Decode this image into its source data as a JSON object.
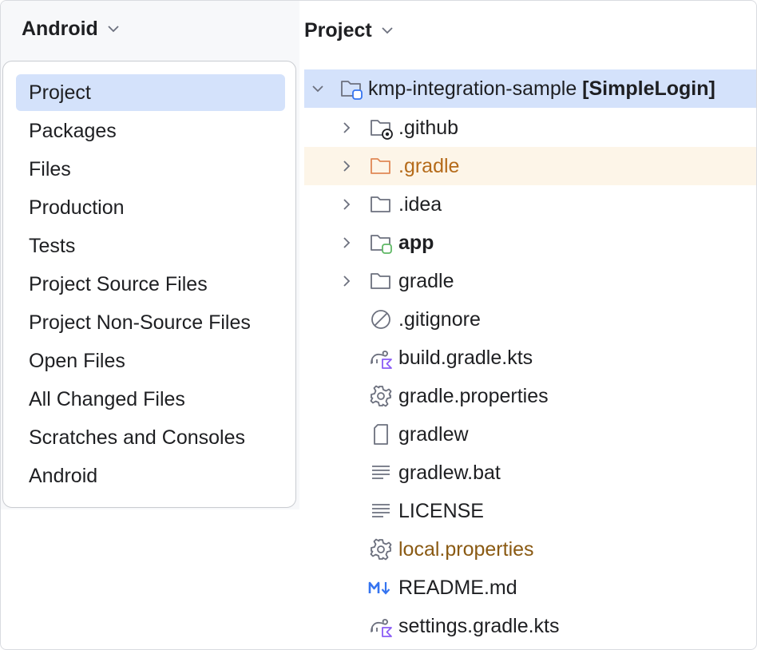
{
  "left_header": {
    "title": "Android"
  },
  "right_header": {
    "title": "Project"
  },
  "view_menu": {
    "items": [
      {
        "label": "Project",
        "selected": true
      },
      {
        "label": "Packages"
      },
      {
        "label": "Files"
      },
      {
        "label": "Production"
      },
      {
        "label": "Tests"
      },
      {
        "label": "Project Source Files"
      },
      {
        "label": "Project Non-Source Files"
      },
      {
        "label": "Open Files"
      },
      {
        "label": "All Changed Files"
      },
      {
        "label": "Scratches and Consoles"
      },
      {
        "label": "Android"
      }
    ]
  },
  "tree": {
    "root": {
      "name": "kmp-integration-sample",
      "module": "[SimpleLogin]",
      "icon": "module-folder-icon",
      "expanded": true
    },
    "items": [
      {
        "name": ".github",
        "icon": "github-folder-icon",
        "expandable": true
      },
      {
        "name": ".gradle",
        "icon": "folder-icon",
        "expandable": true,
        "color": "#b56b1a"
      },
      {
        "name": ".idea",
        "icon": "folder-icon",
        "expandable": true
      },
      {
        "name": "app",
        "icon": "module-folder-icon",
        "expandable": true,
        "bold": true
      },
      {
        "name": "gradle",
        "icon": "folder-icon",
        "expandable": true
      },
      {
        "name": ".gitignore",
        "icon": "ignored-file-icon"
      },
      {
        "name": "build.gradle.kts",
        "icon": "gradle-kotlin-icon"
      },
      {
        "name": "gradle.properties",
        "icon": "gear-icon"
      },
      {
        "name": "gradlew",
        "icon": "file-icon"
      },
      {
        "name": "gradlew.bat",
        "icon": "text-file-icon"
      },
      {
        "name": "LICENSE",
        "icon": "text-file-icon"
      },
      {
        "name": "local.properties",
        "icon": "gear-icon",
        "color": "#8a5a13"
      },
      {
        "name": "README.md",
        "icon": "markdown-icon"
      },
      {
        "name": "settings.gradle.kts",
        "icon": "gradle-kotlin-icon"
      }
    ]
  },
  "colors": {
    "selection": "#d4e2fb",
    "row_highlight": "#fdf5e8",
    "accent_blue": "#3574f0",
    "module_green": "#5fb865"
  }
}
